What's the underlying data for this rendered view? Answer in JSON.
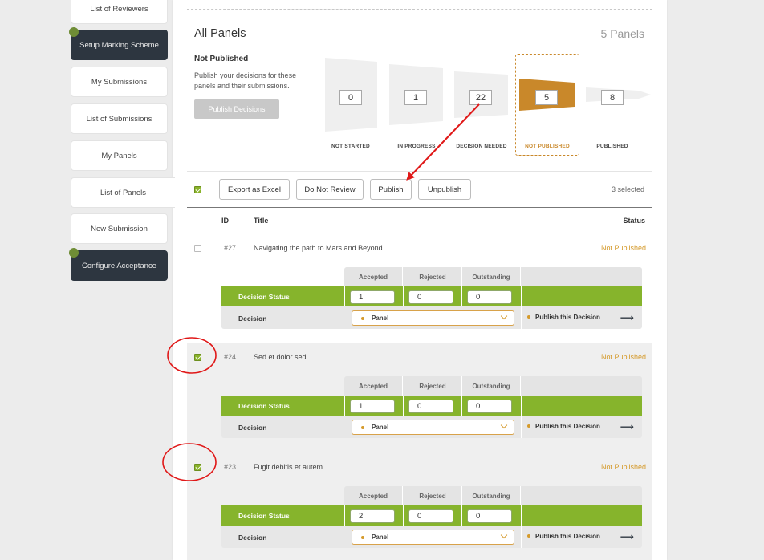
{
  "sidebar": {
    "items": [
      {
        "label": "List of Reviewers",
        "style": "light"
      },
      {
        "label": "Setup Marking Scheme",
        "style": "dark"
      },
      {
        "label": "My Submissions",
        "style": "light"
      },
      {
        "label": "List of Submissions",
        "style": "light"
      },
      {
        "label": "My Panels",
        "style": "light"
      },
      {
        "label": "List of Panels",
        "style": "active"
      },
      {
        "label": "New Submission",
        "style": "light"
      },
      {
        "label": "Configure Acceptance",
        "style": "dark"
      }
    ]
  },
  "header": {
    "title": "All Panels",
    "count": "5 Panels"
  },
  "not_published": {
    "heading": "Not Published",
    "description": "Publish your decisions for these panels and their submissions.",
    "button": "Publish Decisions"
  },
  "funnel": {
    "stages": [
      {
        "label": "NOT STARTED",
        "value": "0"
      },
      {
        "label": "IN PROGRESS",
        "value": "1"
      },
      {
        "label": "DECISION NEEDED",
        "value": "22"
      },
      {
        "label": "NOT PUBLISHED",
        "value": "5"
      },
      {
        "label": "PUBLISHED",
        "value": "8"
      }
    ],
    "highlight_color": "#c9882a"
  },
  "toolbar": {
    "buttons": [
      "Export as Excel",
      "Do Not Review",
      "Publish",
      "Unpublish"
    ],
    "selected_text": "3 selected"
  },
  "table": {
    "headers": {
      "id": "ID",
      "title": "Title",
      "status": "Status"
    },
    "decision_headers": [
      "Accepted",
      "Rejected",
      "Outstanding"
    ],
    "decision_status_label": "Decision Status",
    "decision_label": "Decision",
    "panel_label": "Panel",
    "publish_decision_label": "Publish this Decision",
    "rows": [
      {
        "id": "#27",
        "title": "Navigating the path to Mars and Beyond",
        "status": "Not Published",
        "checked": false,
        "accepted": "1",
        "rejected": "0",
        "outstanding": "0"
      },
      {
        "id": "#24",
        "title": "Sed et dolor sed.",
        "status": "Not Published",
        "checked": true,
        "accepted": "1",
        "rejected": "0",
        "outstanding": "0"
      },
      {
        "id": "#23",
        "title": "Fugit debitis et autem.",
        "status": "Not Published",
        "checked": true,
        "accepted": "2",
        "rejected": "0",
        "outstanding": "0"
      }
    ]
  },
  "colors": {
    "accent_green": "#86b42c",
    "accent_orange": "#d59a2b",
    "dark": "#2d3640",
    "annotation_red": "#e01818"
  }
}
